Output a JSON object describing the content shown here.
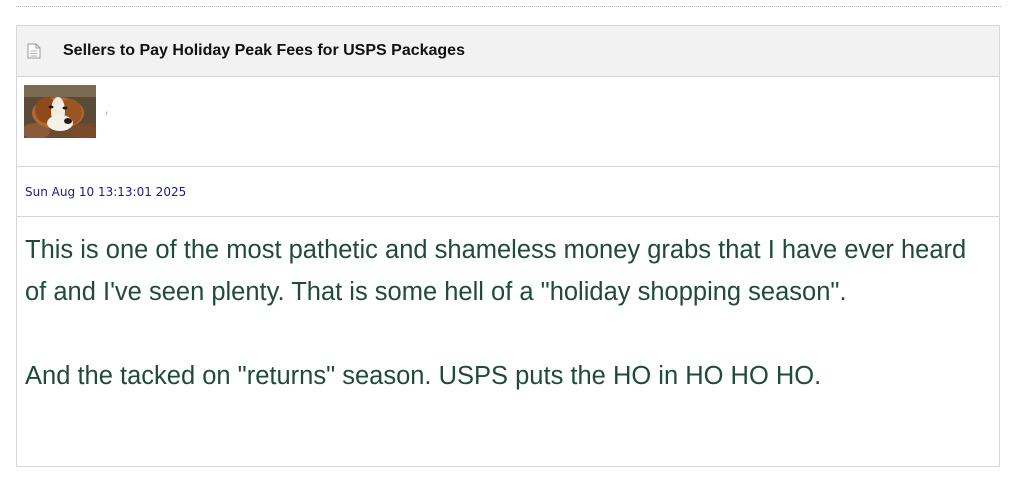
{
  "post": {
    "title": "Sellers to Pay Holiday Peak Fees for USPS Packages",
    "icon": "document-icon",
    "author_mark": "ı",
    "date": "Sun Aug 10 13:13:01 2025",
    "paragraph_1": "This is one of the most pathetic and shameless money grabs that I have ever heard of and I've seen plenty. That is some hell of a \"holiday shopping season\".",
    "paragraph_2": "And the tacked on \"returns\" season.  USPS puts the HO in HO HO HO."
  },
  "colors": {
    "header_bg": "#f2f2f2",
    "border": "#d6d6d6",
    "date_text": "#1a1a8c",
    "body_text": "#1f4a3c"
  }
}
